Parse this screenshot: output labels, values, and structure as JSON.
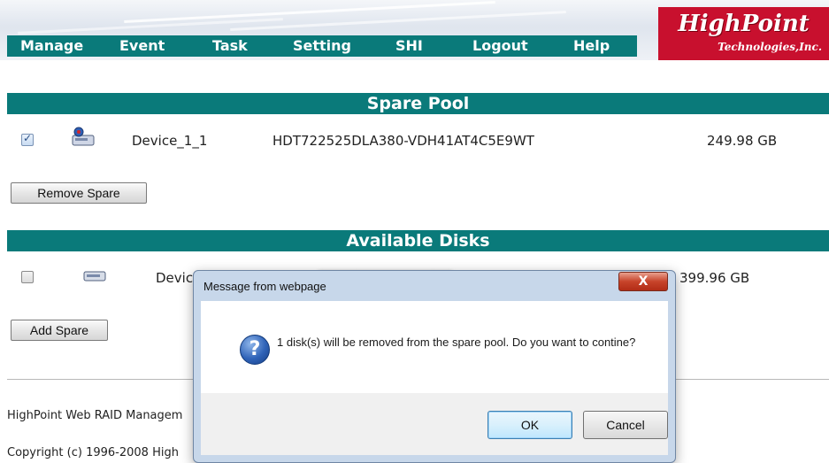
{
  "nav": {
    "items": [
      "Manage",
      "Event",
      "Task",
      "Setting",
      "SHI",
      "Logout",
      "Help"
    ]
  },
  "logo": {
    "line1": "HighPoint",
    "line2": "Technologies,Inc."
  },
  "spare_pool": {
    "title": "Spare Pool",
    "rows": [
      {
        "checked": true,
        "device": "Device_1_1",
        "model": "HDT722525DLA380-VDH41AT4C5E9WT",
        "capacity": "249.98 GB"
      }
    ],
    "button": "Remove Spare"
  },
  "available_disks": {
    "title": "Available Disks",
    "rows": [
      {
        "checked": false,
        "device": "Devic",
        "capacity": "399.96 GB"
      }
    ],
    "button": "Add Spare"
  },
  "footer": {
    "line1": "HighPoint Web RAID Managem",
    "line2": "Copyright (c) 1996-2008 High"
  },
  "dialog": {
    "title": "Message from webpage",
    "close": "X",
    "message": "1 disk(s) will be removed from the spare pool. Do you want to contine?",
    "ok": "OK",
    "cancel": "Cancel"
  },
  "colors": {
    "nav_bg": "#0a7a7a",
    "logo_bg": "#c8102e",
    "section_bg": "#0a7a7a"
  }
}
